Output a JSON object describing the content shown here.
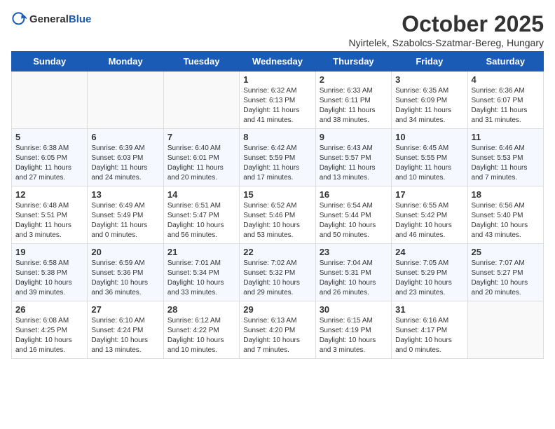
{
  "header": {
    "logo_general": "General",
    "logo_blue": "Blue",
    "title": "October 2025",
    "subtitle": "Nyirtelek, Szabolcs-Szatmar-Bereg, Hungary"
  },
  "weekdays": [
    "Sunday",
    "Monday",
    "Tuesday",
    "Wednesday",
    "Thursday",
    "Friday",
    "Saturday"
  ],
  "weeks": [
    [
      {
        "day": "",
        "info": ""
      },
      {
        "day": "",
        "info": ""
      },
      {
        "day": "",
        "info": ""
      },
      {
        "day": "1",
        "info": "Sunrise: 6:32 AM\nSunset: 6:13 PM\nDaylight: 11 hours\nand 41 minutes."
      },
      {
        "day": "2",
        "info": "Sunrise: 6:33 AM\nSunset: 6:11 PM\nDaylight: 11 hours\nand 38 minutes."
      },
      {
        "day": "3",
        "info": "Sunrise: 6:35 AM\nSunset: 6:09 PM\nDaylight: 11 hours\nand 34 minutes."
      },
      {
        "day": "4",
        "info": "Sunrise: 6:36 AM\nSunset: 6:07 PM\nDaylight: 11 hours\nand 31 minutes."
      }
    ],
    [
      {
        "day": "5",
        "info": "Sunrise: 6:38 AM\nSunset: 6:05 PM\nDaylight: 11 hours\nand 27 minutes."
      },
      {
        "day": "6",
        "info": "Sunrise: 6:39 AM\nSunset: 6:03 PM\nDaylight: 11 hours\nand 24 minutes."
      },
      {
        "day": "7",
        "info": "Sunrise: 6:40 AM\nSunset: 6:01 PM\nDaylight: 11 hours\nand 20 minutes."
      },
      {
        "day": "8",
        "info": "Sunrise: 6:42 AM\nSunset: 5:59 PM\nDaylight: 11 hours\nand 17 minutes."
      },
      {
        "day": "9",
        "info": "Sunrise: 6:43 AM\nSunset: 5:57 PM\nDaylight: 11 hours\nand 13 minutes."
      },
      {
        "day": "10",
        "info": "Sunrise: 6:45 AM\nSunset: 5:55 PM\nDaylight: 11 hours\nand 10 minutes."
      },
      {
        "day": "11",
        "info": "Sunrise: 6:46 AM\nSunset: 5:53 PM\nDaylight: 11 hours\nand 7 minutes."
      }
    ],
    [
      {
        "day": "12",
        "info": "Sunrise: 6:48 AM\nSunset: 5:51 PM\nDaylight: 11 hours\nand 3 minutes."
      },
      {
        "day": "13",
        "info": "Sunrise: 6:49 AM\nSunset: 5:49 PM\nDaylight: 11 hours\nand 0 minutes."
      },
      {
        "day": "14",
        "info": "Sunrise: 6:51 AM\nSunset: 5:47 PM\nDaylight: 10 hours\nand 56 minutes."
      },
      {
        "day": "15",
        "info": "Sunrise: 6:52 AM\nSunset: 5:46 PM\nDaylight: 10 hours\nand 53 minutes."
      },
      {
        "day": "16",
        "info": "Sunrise: 6:54 AM\nSunset: 5:44 PM\nDaylight: 10 hours\nand 50 minutes."
      },
      {
        "day": "17",
        "info": "Sunrise: 6:55 AM\nSunset: 5:42 PM\nDaylight: 10 hours\nand 46 minutes."
      },
      {
        "day": "18",
        "info": "Sunrise: 6:56 AM\nSunset: 5:40 PM\nDaylight: 10 hours\nand 43 minutes."
      }
    ],
    [
      {
        "day": "19",
        "info": "Sunrise: 6:58 AM\nSunset: 5:38 PM\nDaylight: 10 hours\nand 39 minutes."
      },
      {
        "day": "20",
        "info": "Sunrise: 6:59 AM\nSunset: 5:36 PM\nDaylight: 10 hours\nand 36 minutes."
      },
      {
        "day": "21",
        "info": "Sunrise: 7:01 AM\nSunset: 5:34 PM\nDaylight: 10 hours\nand 33 minutes."
      },
      {
        "day": "22",
        "info": "Sunrise: 7:02 AM\nSunset: 5:32 PM\nDaylight: 10 hours\nand 29 minutes."
      },
      {
        "day": "23",
        "info": "Sunrise: 7:04 AM\nSunset: 5:31 PM\nDaylight: 10 hours\nand 26 minutes."
      },
      {
        "day": "24",
        "info": "Sunrise: 7:05 AM\nSunset: 5:29 PM\nDaylight: 10 hours\nand 23 minutes."
      },
      {
        "day": "25",
        "info": "Sunrise: 7:07 AM\nSunset: 5:27 PM\nDaylight: 10 hours\nand 20 minutes."
      }
    ],
    [
      {
        "day": "26",
        "info": "Sunrise: 6:08 AM\nSunset: 4:25 PM\nDaylight: 10 hours\nand 16 minutes."
      },
      {
        "day": "27",
        "info": "Sunrise: 6:10 AM\nSunset: 4:24 PM\nDaylight: 10 hours\nand 13 minutes."
      },
      {
        "day": "28",
        "info": "Sunrise: 6:12 AM\nSunset: 4:22 PM\nDaylight: 10 hours\nand 10 minutes."
      },
      {
        "day": "29",
        "info": "Sunrise: 6:13 AM\nSunset: 4:20 PM\nDaylight: 10 hours\nand 7 minutes."
      },
      {
        "day": "30",
        "info": "Sunrise: 6:15 AM\nSunset: 4:19 PM\nDaylight: 10 hours\nand 3 minutes."
      },
      {
        "day": "31",
        "info": "Sunrise: 6:16 AM\nSunset: 4:17 PM\nDaylight: 10 hours\nand 0 minutes."
      },
      {
        "day": "",
        "info": ""
      }
    ]
  ]
}
